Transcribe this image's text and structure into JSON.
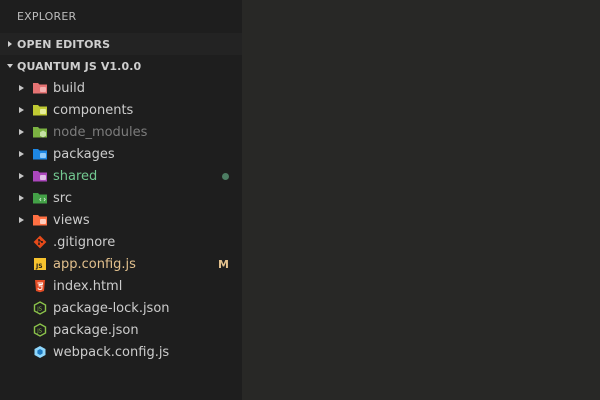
{
  "sidebar": {
    "title": "EXPLORER",
    "sections": {
      "open_editors": "OPEN EDITORS",
      "project": "QUANTUM JS V1.0.0"
    },
    "items": [
      {
        "name": "build",
        "type": "folder",
        "icon": "folder-build-icon"
      },
      {
        "name": "components",
        "type": "folder",
        "icon": "folder-components-icon"
      },
      {
        "name": "node_modules",
        "type": "folder",
        "icon": "folder-node-icon"
      },
      {
        "name": "packages",
        "type": "folder",
        "icon": "folder-packages-icon"
      },
      {
        "name": "shared",
        "type": "folder",
        "icon": "folder-shared-icon"
      },
      {
        "name": "src",
        "type": "folder",
        "icon": "folder-src-icon"
      },
      {
        "name": "views",
        "type": "folder",
        "icon": "folder-views-icon"
      },
      {
        "name": ".gitignore",
        "type": "file",
        "icon": "git-icon"
      },
      {
        "name": "app.config.js",
        "type": "file",
        "icon": "javascript-icon",
        "status": "M"
      },
      {
        "name": "index.html",
        "type": "file",
        "icon": "html5-icon"
      },
      {
        "name": "package-lock.json",
        "type": "file",
        "icon": "nodejs-icon"
      },
      {
        "name": "package.json",
        "type": "file",
        "icon": "nodejs-icon"
      },
      {
        "name": "webpack.config.js",
        "type": "file",
        "icon": "webpack-icon"
      }
    ]
  },
  "colors": {
    "sidebar_bg": "#1e1e1e",
    "editor_bg": "#282826",
    "modified_text": "#e2c08d",
    "untracked_text": "#73c991",
    "ignored_text": "#7c7c7c"
  }
}
